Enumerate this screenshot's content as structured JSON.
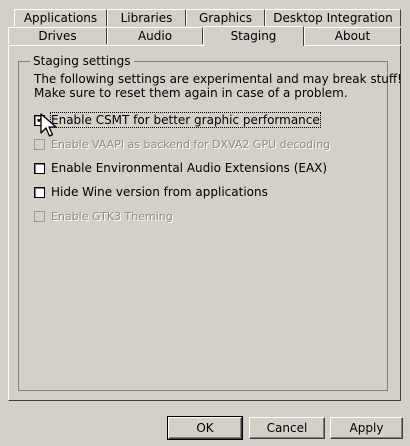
{
  "tabs_row1": [
    "Applications",
    "Libraries",
    "Graphics",
    "Desktop Integration"
  ],
  "tabs_row2": [
    "Drives",
    "Audio",
    "Staging",
    "About"
  ],
  "active_tab": "Staging",
  "group_title": "Staging settings",
  "description_line1": "The following settings are experimental and may break stuff!",
  "description_line2": "Make sure to reset them again in case of a problem.",
  "options": [
    {
      "label": "Enable CSMT for better graphic performance",
      "checked": true,
      "enabled": true
    },
    {
      "label": "Enable VAAPI as backend for DXVA2 GPU decoding",
      "checked": false,
      "enabled": false
    },
    {
      "label": "Enable Environmental Audio Extensions (EAX)",
      "checked": false,
      "enabled": true
    },
    {
      "label": "Hide Wine version from applications",
      "checked": false,
      "enabled": true
    },
    {
      "label": "Enable GTK3 Theming",
      "checked": false,
      "enabled": false
    }
  ],
  "buttons": {
    "ok": "OK",
    "cancel": "Cancel",
    "apply": "Apply"
  }
}
